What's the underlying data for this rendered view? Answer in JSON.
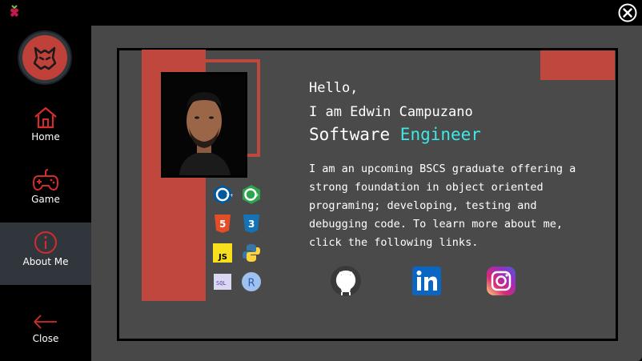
{
  "window": {
    "close_icon": "close-circle-icon",
    "app_icon": "raspberry-icon"
  },
  "sidebar": {
    "logo_icon": "wolf-logo-icon",
    "items": [
      {
        "label": "Home",
        "icon": "home-icon"
      },
      {
        "label": "Game",
        "icon": "gamepad-icon"
      },
      {
        "label": "About Me",
        "icon": "info-icon",
        "active": true
      },
      {
        "label": "Close",
        "icon": "arrow-left-icon"
      }
    ]
  },
  "profile": {
    "greeting": "Hello,",
    "intro": "I am Edwin Campuzano",
    "role_prefix": "Software ",
    "role_highlight": "Engineer",
    "bio": "I am an upcoming BSCS graduate offering a strong foundation in object oriented programing; developing, testing and debugging code. To learn more about me, click the following links.",
    "skills": [
      "C++",
      "C#",
      "HTML5",
      "CSS3",
      "JS",
      "Python",
      "SQL",
      "R"
    ],
    "links": [
      "github-icon",
      "linkedin-icon",
      "instagram-icon"
    ]
  },
  "colors": {
    "accent": "#c0473d",
    "highlight": "#3de8e8",
    "panel": "#484848",
    "active_nav": "#31363d"
  }
}
